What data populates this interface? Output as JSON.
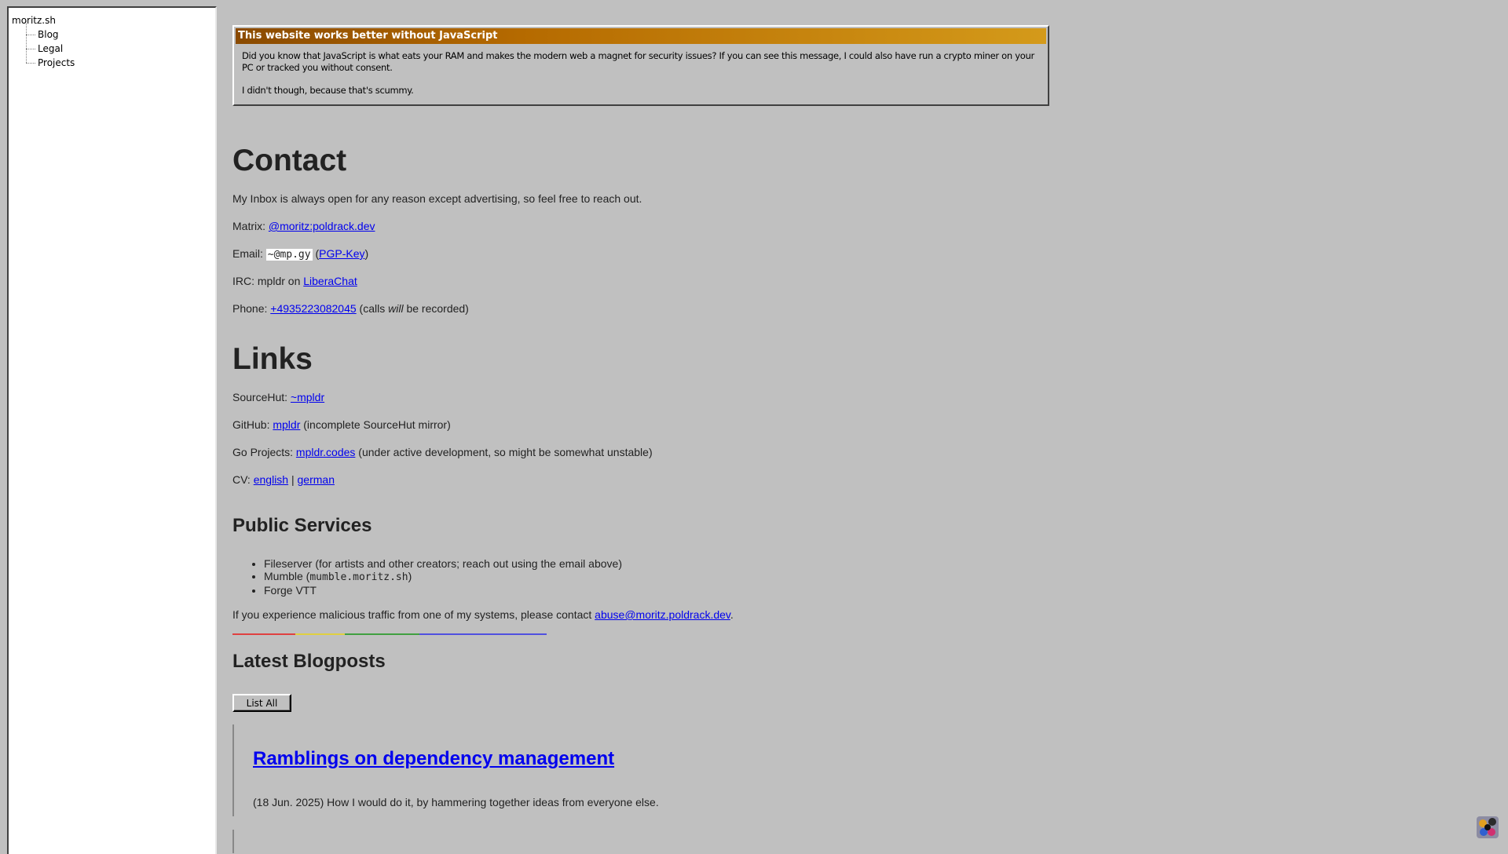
{
  "sidebar": {
    "root": "moritz.sh",
    "items": [
      {
        "label": "Blog"
      },
      {
        "label": "Legal"
      },
      {
        "label": "Projects"
      }
    ]
  },
  "notice": {
    "title": "This website works better without JavaScript",
    "para1": "Did you know that JavaScript is what eats your RAM and makes the modern web a magnet for security issues? If you can see this message, I could also have run a crypto miner on your PC or tracked you without consent.",
    "para2": "I didn't though, because that's scummy."
  },
  "contact": {
    "heading": "Contact",
    "intro": "My Inbox is always open for any reason except advertising, so feel free to reach out.",
    "matrix_label": "Matrix: ",
    "matrix_link": "@moritz:poldrack.dev",
    "email_label": "Email: ",
    "email_code": "~@mp.gy",
    "email_open": " (",
    "email_link": "PGP-Key",
    "email_close": ")",
    "irc_label": "IRC: mpldr on ",
    "irc_link": "LiberaChat",
    "phone_label": "Phone: ",
    "phone_link": "+4935223082045",
    "phone_pre": " (calls ",
    "phone_em": "will",
    "phone_post": " be recorded)"
  },
  "links": {
    "heading": "Links",
    "sourcehut_label": "SourceHut: ",
    "sourcehut_link": "~mpldr",
    "github_label": "GitHub: ",
    "github_link": "mpldr",
    "github_note": " (incomplete SourceHut mirror)",
    "go_label": "Go Projects: ",
    "go_link": "mpldr.codes",
    "go_note": " (under active development, so might be somewhat unstable)",
    "cv_label": "CV: ",
    "cv_english": "english",
    "cv_sep": " | ",
    "cv_german": "german"
  },
  "services": {
    "heading": "Public Services",
    "item1": "Fileserver (for artists and other creators; reach out using the email above)",
    "item2_pre": "Mumble (",
    "item2_code": "mumble.moritz.sh",
    "item2_post": ")",
    "item3": "Forge VTT",
    "abuse_pre": "If you experience malicious traffic from one of my systems, please contact ",
    "abuse_link": "abuse@moritz.poldrack.dev",
    "abuse_post": "."
  },
  "blog": {
    "heading": "Latest Blogposts",
    "list_all": "List All",
    "post_title": "Ramblings on dependency management",
    "post_desc": "(18 Jun. 2025) How I would do it, by hammering together ideas from everyone else."
  },
  "colors": {
    "background": "#c0c0c0",
    "link": "#0000ee",
    "titlebar_start": "#8a4a00",
    "titlebar_end": "#d49a1a",
    "rainbow": [
      "#e04040",
      "#e0d040",
      "#40a040",
      "#5050e0"
    ]
  },
  "icons": {
    "corner": "colorful-dots-icon"
  }
}
